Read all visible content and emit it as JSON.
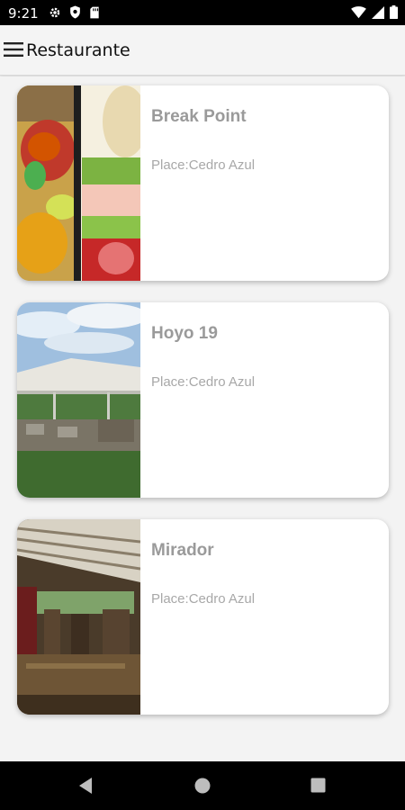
{
  "status_bar": {
    "time": "9:21"
  },
  "app_bar": {
    "title": "Restaurante"
  },
  "restaurants": [
    {
      "name": "Break Point",
      "place": "Place:Cedro Azul"
    },
    {
      "name": "Hoyo 19",
      "place": "Place:Cedro Azul"
    },
    {
      "name": "Mirador",
      "place": "Place:Cedro Azul"
    }
  ]
}
